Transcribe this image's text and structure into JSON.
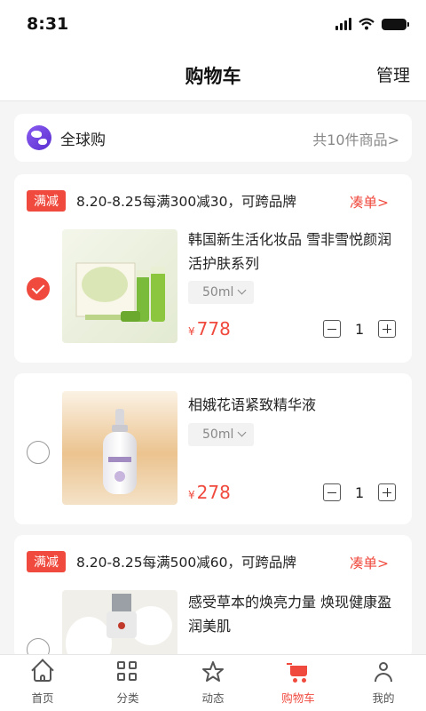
{
  "status": {
    "time": "8:31"
  },
  "header": {
    "title": "购物车",
    "manage": "管理"
  },
  "global": {
    "label": "全球购",
    "count": "共10件商品>"
  },
  "groups": [
    {
      "badge": "满减",
      "promo": "8.20-8.25每满300减30，可跨品牌",
      "link": "凑单>",
      "items": [
        {
          "name": "韩国新生活化妆品 雪非雪悦颜润活护肤系列",
          "spec": "50ml",
          "currency": "¥",
          "price": "778",
          "qty": "1",
          "checked": true
        }
      ]
    },
    {
      "items": [
        {
          "name": "相娥花语紧致精华液",
          "spec": "50ml",
          "currency": "¥",
          "price": "278",
          "qty": "1",
          "checked": false
        }
      ]
    },
    {
      "badge": "满减",
      "promo": "8.20-8.25每满500减60，可跨品牌",
      "link": "凑单>",
      "items": [
        {
          "name": "感受草本的焕亮力量 焕现健康盈润美肌",
          "checked": false
        }
      ]
    }
  ],
  "tabs": [
    {
      "label": "首页",
      "icon": "home-icon"
    },
    {
      "label": "分类",
      "icon": "category-icon"
    },
    {
      "label": "动态",
      "icon": "star-icon"
    },
    {
      "label": "购物车",
      "icon": "cart-icon",
      "active": true
    },
    {
      "label": "我的",
      "icon": "user-icon"
    }
  ],
  "colors": {
    "accent": "#f04a3e",
    "background": "#f5f5f5"
  }
}
